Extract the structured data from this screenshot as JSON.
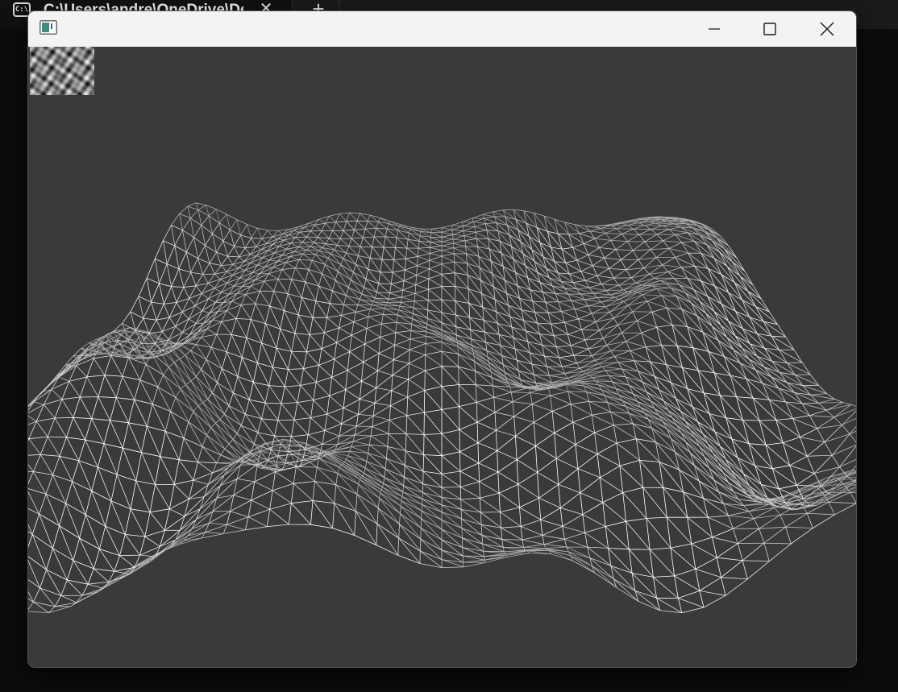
{
  "terminal": {
    "tab_title": "C:\\Users\\andre\\OneDrive\\Des",
    "tab_icon_glyph": "C:\\",
    "close_glyph": "✕",
    "new_tab_glyph": "+",
    "dropdown_glyph": "⌄",
    "icons": {
      "tab_icon": "terminal-icon",
      "close": "close-icon",
      "new_tab": "plus-icon",
      "dropdown": "chevron-down-icon"
    }
  },
  "window": {
    "app_icon": "app-window-icon",
    "controls": [
      "minimize-icon",
      "maximize-icon",
      "close-icon"
    ],
    "background_color": "#3a3a3a",
    "titlebar_color": "#f3f3f3"
  },
  "viewport": {
    "content": "wireframe-terrain-render",
    "noise_texture": "noise-texture-thumbnail",
    "wire_color": "#ffffff"
  }
}
